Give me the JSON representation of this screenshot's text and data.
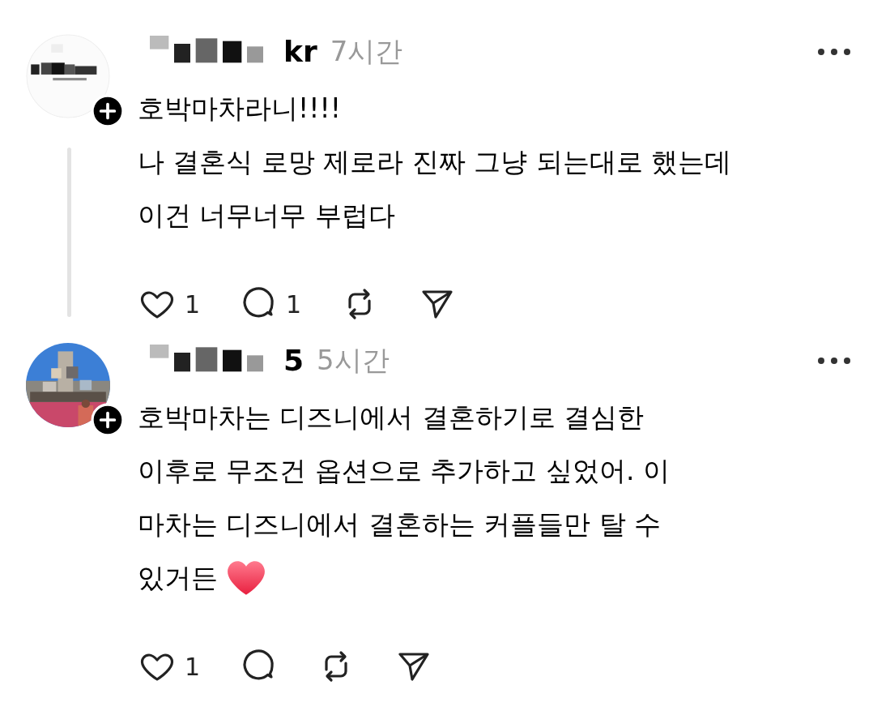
{
  "comments": [
    {
      "username": "kr",
      "time": "7시간",
      "thread_line": true,
      "lines": [
        "호박마차라니!!!!",
        "나 결혼식 로망 제로라 진짜 그냥 되는대로 했는데",
        "이건 너무너무 부럽다"
      ],
      "heart_emoji": false,
      "like_count": "1",
      "reply_count": "1"
    },
    {
      "username": "5",
      "time": "5시간",
      "thread_line": false,
      "lines": [
        "호박마차는 디즈니에서 결혼하기로 결심한",
        "이후로 무조건 옵션으로 추가하고 싶었어. 이",
        "마차는 디즈니에서 결혼하는 커플들만 탈 수",
        "있거든"
      ],
      "heart_emoji": true,
      "like_count": "1"
    }
  ]
}
